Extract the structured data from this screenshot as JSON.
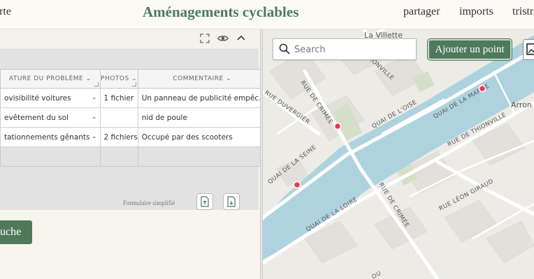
{
  "header": {
    "left_link": "arte",
    "title": "Aménagements cyclables",
    "nav": [
      "partager",
      "imports",
      "tristra"
    ]
  },
  "table": {
    "columns": [
      "ATURE DU PROBLÈME",
      "PHOTOS",
      "COMMENTAIRE"
    ],
    "rows": [
      [
        "ovisibilité voitures",
        "1 fichier",
        "Un panneau de publicité empêc…"
      ],
      [
        "evêtement du sol",
        "",
        "nid de poule"
      ],
      [
        "tationnements gênants",
        "2 fichiers",
        "Occupé par des scooters"
      ]
    ]
  },
  "form": {
    "simplified_label": "Formulaire simplifié",
    "left_button": "uche"
  },
  "map": {
    "search_placeholder": "Search",
    "add_point": "Ajouter un point",
    "labels": {
      "la_villette": "La Villette",
      "arron": "Arron",
      "quai_marne": "QUAI DE LA MARNE",
      "quai_oise": "QUAI DE L'OISE",
      "quai_seine": "QUAI DE LA SEINE",
      "quai_loire": "QUAI DE LA LOIRE",
      "rue_crimee_1": "RUE DE CRIMÉE",
      "rue_crimee_2": "RUE DE CRIMÉE",
      "rue_duvergier": "RUE DUVERGIER",
      "rue_thionville": "RUE DE THIONVILLE",
      "rue_giraud": "RUE LÉON GIRAUD",
      "thionville_top": "HIONVILLE",
      "bottom_ou": "OU"
    },
    "colors": {
      "water": "#aed3df",
      "park": "#d6dfc8",
      "road": "#ffffff",
      "marker": "#e8384f"
    }
  }
}
